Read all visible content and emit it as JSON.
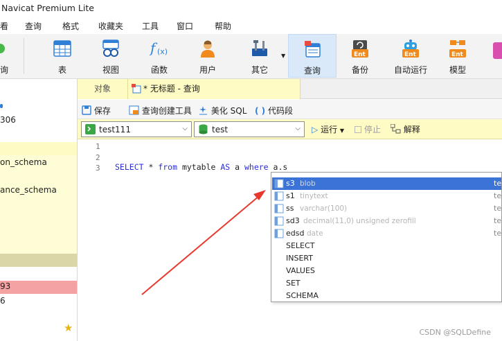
{
  "app": {
    "title": "Navicat Premium Lite"
  },
  "menu": [
    "看",
    "查询",
    "格式",
    "收藏夹",
    "工具",
    "窗口",
    "帮助"
  ],
  "toolbar": {
    "partial_left_label": "询",
    "items": [
      {
        "label": "表",
        "icon": "table-icon"
      },
      {
        "label": "视图",
        "icon": "view-icon"
      },
      {
        "label": "函数",
        "icon": "function-icon"
      },
      {
        "label": "用户",
        "icon": "user-icon"
      },
      {
        "label": "其它",
        "icon": "tools-icon"
      },
      {
        "label": "查询",
        "icon": "query-icon"
      },
      {
        "label": "备份",
        "icon": "backup-icon"
      },
      {
        "label": "自动运行",
        "icon": "robot-icon"
      },
      {
        "label": "模型",
        "icon": "model-icon"
      }
    ]
  },
  "sidebar": {
    "rows": [
      "306",
      "on_schema",
      "ance_schema",
      "93",
      "6"
    ]
  },
  "tabs": {
    "objects": "对象",
    "query": "* 无标题 - 查询"
  },
  "query_toolbar": {
    "save": "保存",
    "builder": "查询创建工具",
    "beautify": "美化 SQL",
    "snippet": "代码段"
  },
  "selectors": {
    "connection": "test111",
    "database": "test",
    "run": "运行",
    "stop": "停止",
    "explain": "解释"
  },
  "editor": {
    "line_numbers": [
      "1",
      "2",
      "3"
    ],
    "tokens": [
      {
        "t": "SELECT",
        "k": true
      },
      {
        "t": " * ",
        "k": false
      },
      {
        "t": "from",
        "k": true
      },
      {
        "t": " mytable ",
        "k": false
      },
      {
        "t": "AS",
        "k": true
      },
      {
        "t": " a ",
        "k": false
      },
      {
        "t": "where",
        "k": true
      },
      {
        "t": " a.s",
        "k": false
      }
    ]
  },
  "autocomplete": {
    "columns": [
      {
        "name": "s3",
        "type": "blob",
        "table": "tes"
      },
      {
        "name": "s1",
        "type": "tinytext",
        "table": "tes"
      },
      {
        "name": "ss",
        "type": "varchar(100)",
        "table": "tes"
      },
      {
        "name": "sd3",
        "type": "decimal(11,0) unsigned zerofill",
        "table": "tes"
      },
      {
        "name": "edsd",
        "type": "date",
        "table": "tes"
      }
    ],
    "keywords": [
      "SELECT",
      "INSERT",
      "VALUES",
      "SET",
      "SCHEMA"
    ]
  },
  "watermark": "CSDN @SQLDefine",
  "colors": {
    "accent": "#3b73d7",
    "tab_yellow": "#fffbc4",
    "arrow_red": "#e8382d"
  }
}
